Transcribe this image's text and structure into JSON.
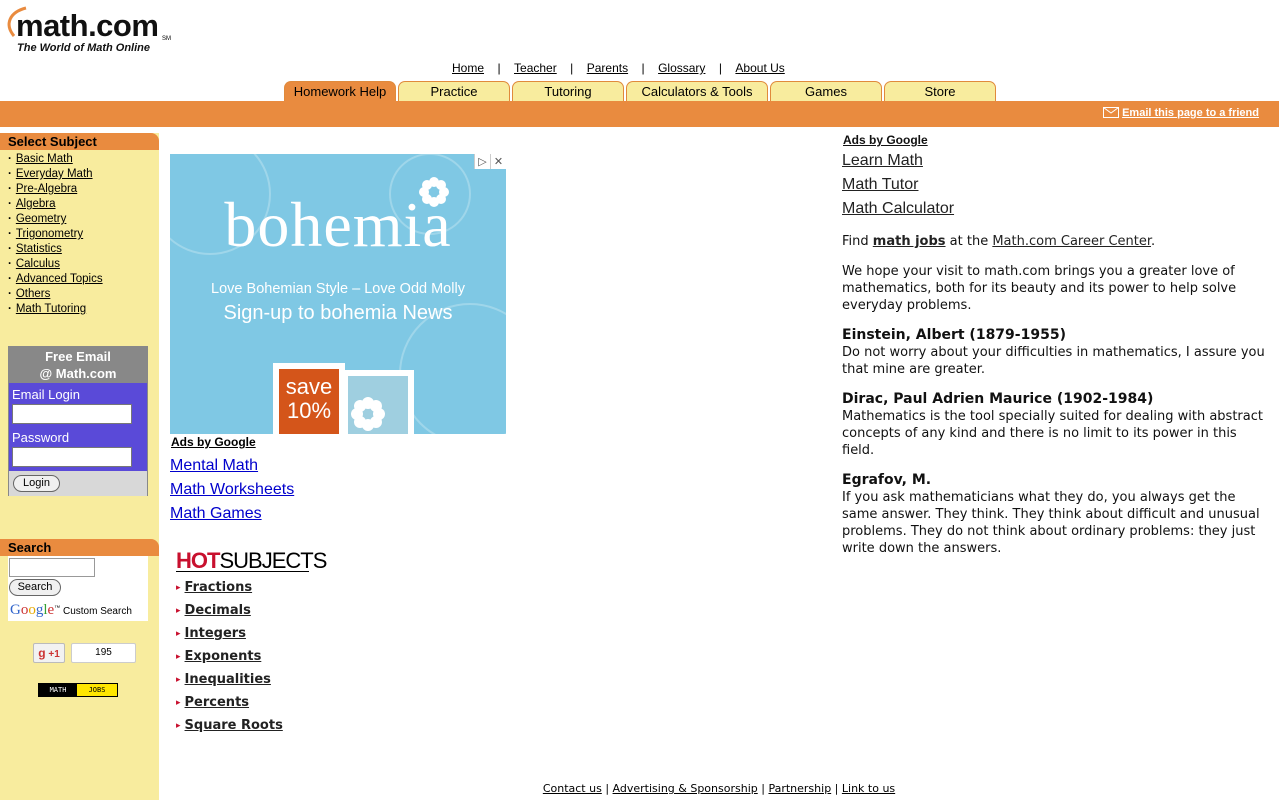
{
  "logo": {
    "wordmark": "math.com",
    "sm": "SM",
    "tagline": "The World of Math Online"
  },
  "top_nav": [
    "Home",
    "Teacher",
    "Parents",
    "Glossary",
    "About Us"
  ],
  "tabs": [
    "Homework Help",
    "Practice",
    "Tutoring",
    "Calculators & Tools",
    "Games",
    "Store"
  ],
  "active_tab": "Homework Help",
  "email_friend": "Email this page to a friend",
  "sidebar": {
    "select_subject": "Select Subject",
    "subjects": [
      "Basic Math",
      "Everyday Math",
      "Pre-Algebra",
      "Algebra",
      "Geometry",
      "Trigonometry",
      "Statistics",
      "Calculus",
      "Advanced Topics",
      "Others",
      "Math Tutoring"
    ],
    "free_email_title": "Free Email\n@ Math.com",
    "email_login_label": "Email Login",
    "password_label": "Password",
    "login_button": "Login",
    "search_title": "Search",
    "search_button": "Search",
    "google_brand": "Google",
    "custom_search": "Custom Search",
    "gplus_label": "+1",
    "gplus_count": "195",
    "mathjobs_left": "MATH",
    "mathjobs_right": "JOBS"
  },
  "banner_ad": {
    "brand": "bohemia",
    "line1": "Love Bohemian Style – Love Odd Molly",
    "line2": "Sign-up to bohemia News",
    "stamp": "save\n10%"
  },
  "middle_ads": {
    "title": "Ads by Google",
    "links": [
      "Mental Math",
      "Math Worksheets",
      "Math Games"
    ]
  },
  "hot_subjects": {
    "hot": "HOT",
    "subjects_word": "SUBJECTS",
    "items": [
      "Fractions",
      "Decimals",
      "Integers",
      "Exponents",
      "Inequalities",
      "Percents",
      "Square Roots"
    ]
  },
  "right_ads": {
    "title": "Ads by Google",
    "links": [
      "Learn Math",
      "Math Tutor",
      "Math Calculator"
    ]
  },
  "right_content": {
    "find_prefix": "Find ",
    "find_link": "math jobs",
    "find_middle": " at the ",
    "find_link2": "Math.com Career Center",
    "find_suffix": ".",
    "intro": "We hope your visit to math.com brings you a greater love of mathematics, both for its beauty and its power to help solve everyday problems.",
    "quotes": [
      {
        "author": "Einstein, Albert (1879-1955)",
        "text": "Do not worry about your difficulties in mathematics, I assure you that mine are greater."
      },
      {
        "author": "Dirac, Paul Adrien Maurice (1902-1984)",
        "text": "Mathematics is the tool specially suited for dealing with abstract concepts of any kind and there is no limit to its power in this field."
      },
      {
        "author": "Egrafov, M.",
        "text": "If you ask mathematicians what they do, you always get the same answer. They think. They think about difficult and unusual problems. They do not think about ordinary problems: they just write down the answers."
      }
    ]
  },
  "footer": [
    "Contact us",
    "Advertising & Sponsorship",
    "Partnership",
    "Link to us"
  ],
  "colors": {
    "orange": "#e98b3f",
    "yellow": "#f8ec9e",
    "login_blue": "#5a4ad8",
    "ad_link": "#0000cc",
    "hot_red": "#c8102e"
  }
}
